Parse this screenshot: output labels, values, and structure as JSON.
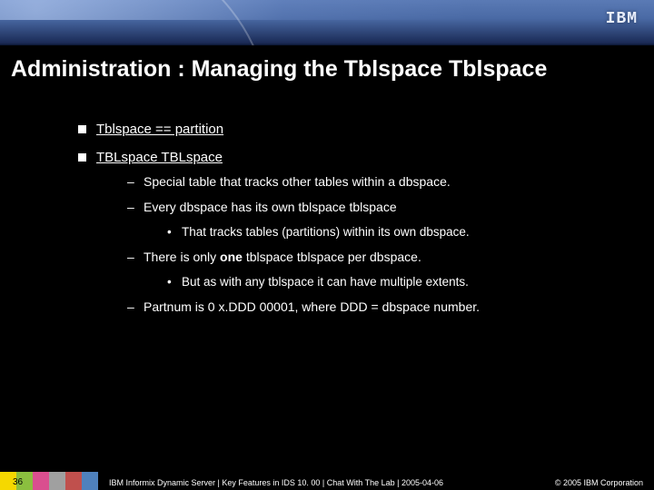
{
  "logo": "IBM",
  "title": "Administration : Managing the Tblspace Tblspace",
  "bullets": [
    {
      "text": "Tblspace == partition"
    },
    {
      "text": "TBLspace TBLspace",
      "sub": [
        {
          "text": "Special table that tracks other tables within a dbspace."
        },
        {
          "text": "Every dbspace has its own tblspace tblspace",
          "sub": [
            {
              "text": "That tracks tables (partitions) within its own dbspace."
            }
          ]
        },
        {
          "prefix": "There is only ",
          "bold": "one",
          "suffix": " tblspace tblspace per dbspace.",
          "sub": [
            {
              "text": "But as with any tblspace it can have multiple extents."
            }
          ]
        },
        {
          "text": "Partnum is 0 x.DDD 00001, where DDD = dbspace number."
        }
      ]
    }
  ],
  "swatches": [
    "#f5d800",
    "#8bbf3f",
    "#d94f8f",
    "#a0a0a0",
    "#c0504d",
    "#4f81bd"
  ],
  "page_number": "36",
  "footer_text": "IBM Informix Dynamic Server  |  Key Features in IDS 10. 00  |  Chat With The Lab  |  2005-04-06",
  "copyright": "© 2005 IBM Corporation"
}
